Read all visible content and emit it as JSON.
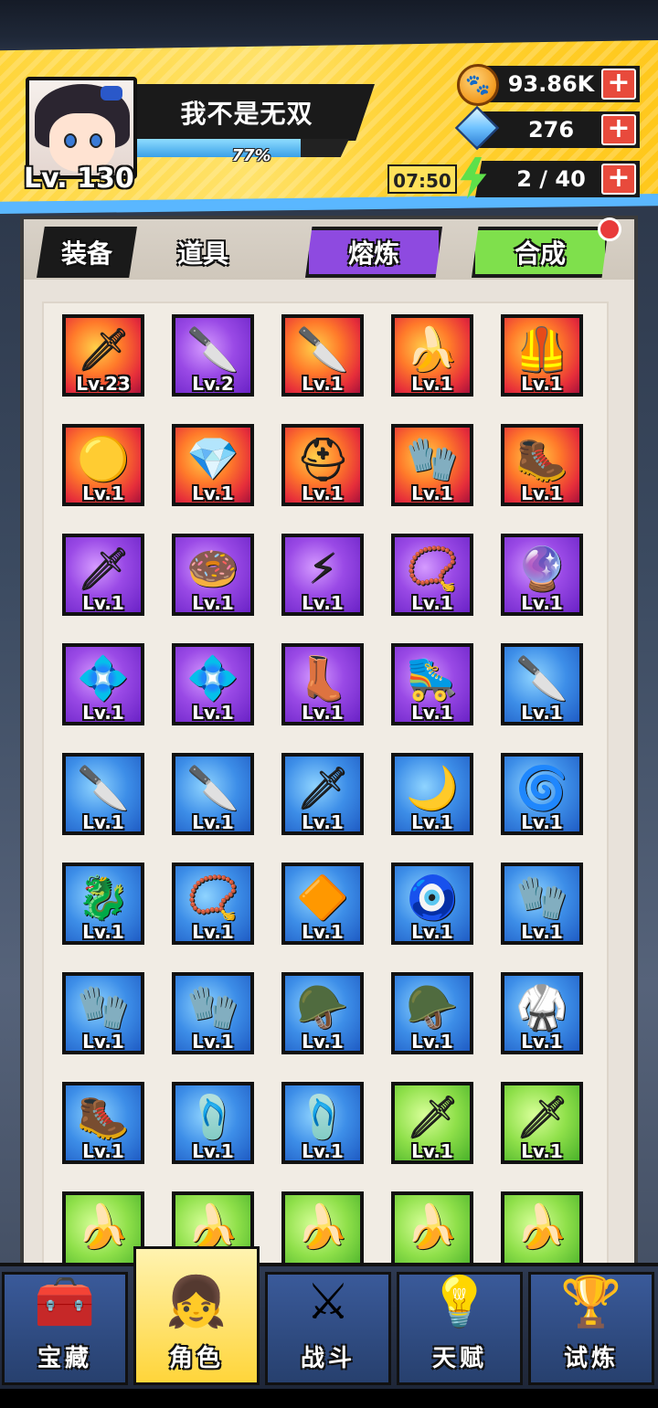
{
  "player": {
    "name": "我不是无双",
    "level_label": "Lv. 130",
    "xp_percent_text": "77%",
    "xp_fraction": 0.77
  },
  "resources": {
    "coins": "93.86K",
    "gems": "276",
    "energy": "2 / 40",
    "energy_timer": "07:50"
  },
  "tabs": {
    "equipment": "装备",
    "items": "道具",
    "smelt": "熔炼",
    "merge": "合成"
  },
  "inventory": [
    {
      "glyph": "🗡",
      "lv": "Lv.23",
      "bg": "red"
    },
    {
      "glyph": "🔪",
      "lv": "Lv.2",
      "bg": "purple"
    },
    {
      "glyph": "🔪",
      "lv": "Lv.1",
      "bg": "red"
    },
    {
      "glyph": "🍌",
      "lv": "Lv.1",
      "bg": "red"
    },
    {
      "glyph": "🦺",
      "lv": "Lv.1",
      "bg": "red"
    },
    {
      "glyph": "🟡",
      "lv": "Lv.1",
      "bg": "red"
    },
    {
      "glyph": "💎",
      "lv": "Lv.1",
      "bg": "red"
    },
    {
      "glyph": "⛑",
      "lv": "Lv.1",
      "bg": "red"
    },
    {
      "glyph": "🧤",
      "lv": "Lv.1",
      "bg": "red"
    },
    {
      "glyph": "🥾",
      "lv": "Lv.1",
      "bg": "red"
    },
    {
      "glyph": "🗡",
      "lv": "Lv.1",
      "bg": "purple"
    },
    {
      "glyph": "🍩",
      "lv": "Lv.1",
      "bg": "purple"
    },
    {
      "glyph": "⚡",
      "lv": "Lv.1",
      "bg": "purple"
    },
    {
      "glyph": "📿",
      "lv": "Lv.1",
      "bg": "purple"
    },
    {
      "glyph": "🔮",
      "lv": "Lv.1",
      "bg": "purple"
    },
    {
      "glyph": "💠",
      "lv": "Lv.1",
      "bg": "purple"
    },
    {
      "glyph": "💠",
      "lv": "Lv.1",
      "bg": "purple"
    },
    {
      "glyph": "👢",
      "lv": "Lv.1",
      "bg": "purple"
    },
    {
      "glyph": "🛼",
      "lv": "Lv.1",
      "bg": "purple"
    },
    {
      "glyph": "🔪",
      "lv": "Lv.1",
      "bg": "blue"
    },
    {
      "glyph": "🔪",
      "lv": "Lv.1",
      "bg": "blue"
    },
    {
      "glyph": "🔪",
      "lv": "Lv.1",
      "bg": "blue"
    },
    {
      "glyph": "🗡",
      "lv": "Lv.1",
      "bg": "blue"
    },
    {
      "glyph": "🌙",
      "lv": "Lv.1",
      "bg": "blue"
    },
    {
      "glyph": "🌀",
      "lv": "Lv.1",
      "bg": "blue"
    },
    {
      "glyph": "🐉",
      "lv": "Lv.1",
      "bg": "blue"
    },
    {
      "glyph": "📿",
      "lv": "Lv.1",
      "bg": "blue"
    },
    {
      "glyph": "🔶",
      "lv": "Lv.1",
      "bg": "blue"
    },
    {
      "glyph": "🧿",
      "lv": "Lv.1",
      "bg": "blue"
    },
    {
      "glyph": "🧤",
      "lv": "Lv.1",
      "bg": "blue"
    },
    {
      "glyph": "🧤",
      "lv": "Lv.1",
      "bg": "blue"
    },
    {
      "glyph": "🧤",
      "lv": "Lv.1",
      "bg": "blue"
    },
    {
      "glyph": "🪖",
      "lv": "Lv.1",
      "bg": "blue"
    },
    {
      "glyph": "🪖",
      "lv": "Lv.1",
      "bg": "blue"
    },
    {
      "glyph": "🥋",
      "lv": "Lv.1",
      "bg": "blue"
    },
    {
      "glyph": "🥾",
      "lv": "Lv.1",
      "bg": "blue"
    },
    {
      "glyph": "🩴",
      "lv": "Lv.1",
      "bg": "blue"
    },
    {
      "glyph": "🩴",
      "lv": "Lv.1",
      "bg": "blue"
    },
    {
      "glyph": "🗡",
      "lv": "Lv.1",
      "bg": "green"
    },
    {
      "glyph": "🗡",
      "lv": "Lv.1",
      "bg": "green"
    },
    {
      "glyph": "🍌",
      "lv": "",
      "bg": "green"
    },
    {
      "glyph": "🍌",
      "lv": "",
      "bg": "green"
    },
    {
      "glyph": "🍌",
      "lv": "",
      "bg": "green"
    },
    {
      "glyph": "🍌",
      "lv": "",
      "bg": "green"
    },
    {
      "glyph": "🍌",
      "lv": "",
      "bg": "green"
    }
  ],
  "nav": [
    {
      "label": "宝藏",
      "icon": "🧰",
      "name": "treasure"
    },
    {
      "label": "角色",
      "icon": "👧",
      "name": "character"
    },
    {
      "label": "战斗",
      "icon": "⚔",
      "name": "battle"
    },
    {
      "label": "天赋",
      "icon": "💡",
      "name": "talent"
    },
    {
      "label": "试炼",
      "icon": "🏆",
      "name": "trial"
    }
  ],
  "nav_active": 1,
  "colors": {
    "header_yellow": "#ffd53a",
    "smelt_purple": "#8e4ae0",
    "merge_green": "#7fe04c",
    "plus_red": "#e84a3c"
  }
}
